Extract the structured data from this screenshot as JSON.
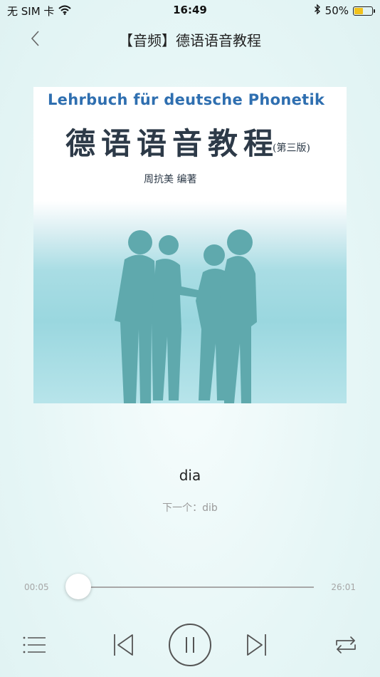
{
  "status_bar": {
    "carrier": "无 SIM 卡",
    "time": "16:49",
    "battery_percent_label": "50%",
    "battery_level": 0.5,
    "icons": [
      "wifi-icon",
      "bluetooth-icon",
      "battery-icon"
    ]
  },
  "nav": {
    "back_icon": "chevron-left-icon",
    "title": "【音频】德语语音教程"
  },
  "cover": {
    "title_en": "Lehrbuch für deutsche Phonetik",
    "title_zh": "德语语音教程",
    "edition": "(第三版)",
    "author": "周抗美  编著"
  },
  "track": {
    "current": "dia",
    "next": "下一个：dib"
  },
  "progress": {
    "elapsed": "00:05",
    "total": "26:01",
    "fraction": 0.003
  },
  "controls": {
    "playlist_icon": "playlist-icon",
    "previous_icon": "previous-track-icon",
    "pause_icon": "pause-icon",
    "next_icon": "next-track-icon",
    "repeat_icon": "repeat-icon"
  },
  "colors": {
    "accent_text": "#222222",
    "muted_text": "#9a9a9a",
    "battery": "#f2c21b",
    "cover_title_en": "#2f6fb0",
    "silhouette": "#5fa9ad"
  }
}
